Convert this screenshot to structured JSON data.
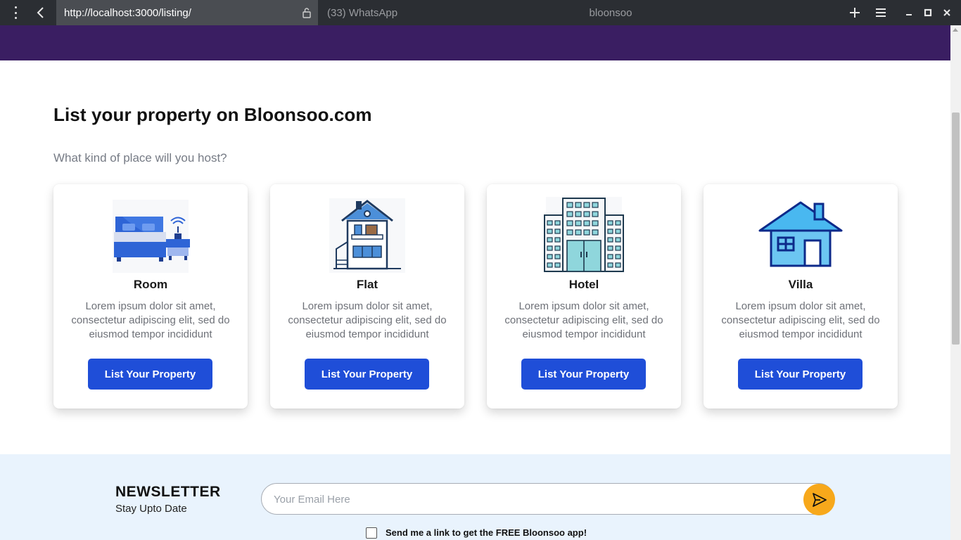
{
  "browser": {
    "url": "http://localhost:3000/listing/",
    "other_tab": "(33) WhatsApp",
    "window_title": "bloonsoo",
    "icons": [
      "menu-icon",
      "back-icon",
      "lock-icon",
      "new-tab-icon",
      "hamburger-icon",
      "minimize-icon",
      "maximize-icon",
      "close-icon"
    ]
  },
  "colors": {
    "header_band": "#3a1e62",
    "button": "#1f4ed8",
    "newsletter_bg": "#e9f3fd",
    "send_button": "#f7a81b"
  },
  "main": {
    "title": "List your property on Bloonsoo.com",
    "subtitle": "What kind of place will you host?",
    "cards": [
      {
        "title": "Room",
        "description": "Lorem ipsum dolor sit amet, consectetur adipiscing elit, sed do eiusmod tempor incididunt",
        "button": "List Your Property",
        "icon": "bedroom-icon"
      },
      {
        "title": "Flat",
        "description": "Lorem ipsum dolor sit amet, consectetur adipiscing elit, sed do eiusmod tempor incididunt",
        "button": "List Your Property",
        "icon": "flat-building-icon"
      },
      {
        "title": "Hotel",
        "description": "Lorem ipsum dolor sit amet, consectetur adipiscing elit, sed do eiusmod tempor incididunt",
        "button": "List Your Property",
        "icon": "hotel-building-icon"
      },
      {
        "title": "Villa",
        "description": "Lorem ipsum dolor sit amet, consectetur adipiscing elit, sed do eiusmod tempor incididunt",
        "button": "List Your Property",
        "icon": "villa-house-icon"
      }
    ]
  },
  "newsletter": {
    "title": "NEWSLETTER",
    "subtitle": "Stay Upto Date",
    "email_placeholder": "Your Email Here",
    "checkbox_label": "Send me a link to get the FREE Bloonsoo app!",
    "send_icon": "send-icon"
  }
}
